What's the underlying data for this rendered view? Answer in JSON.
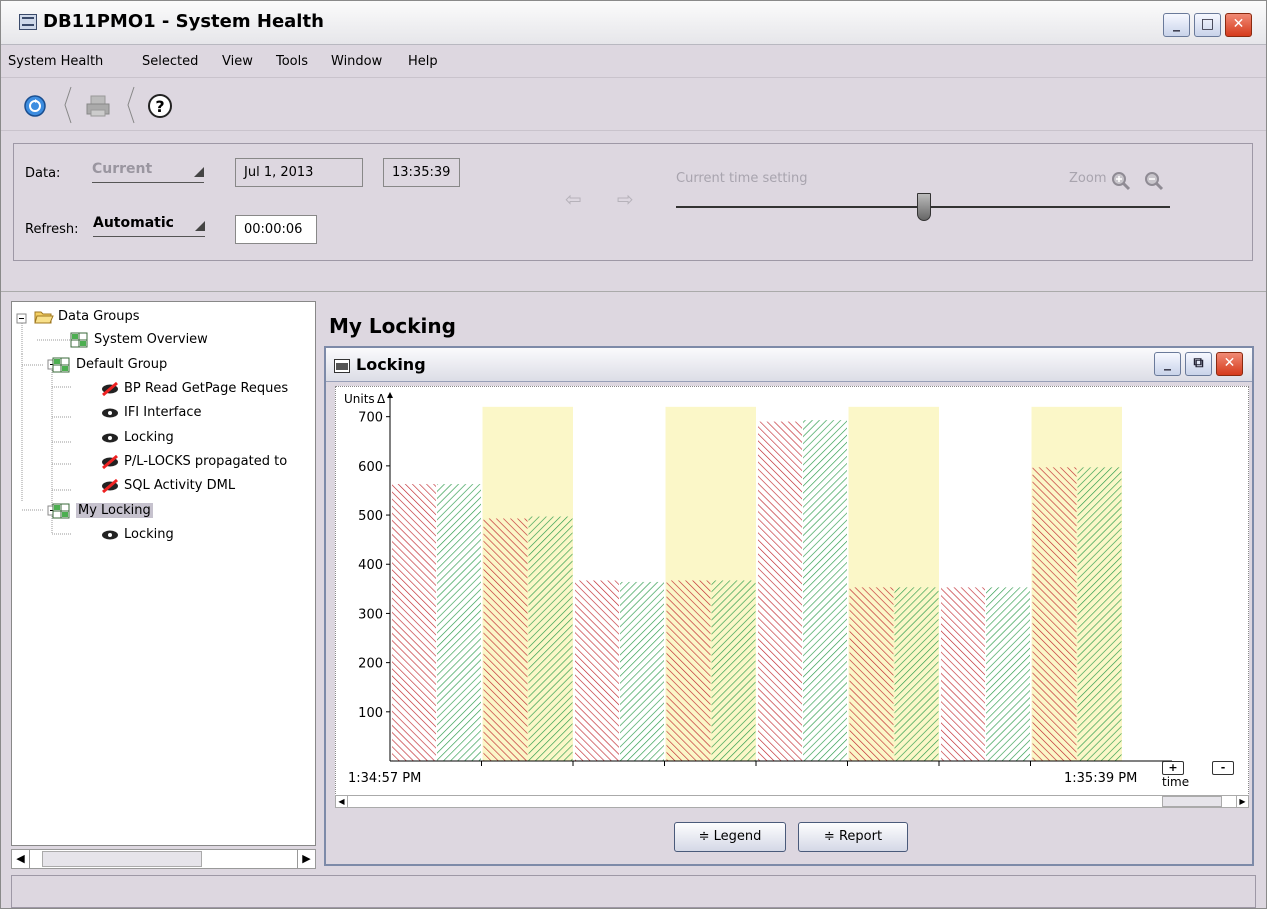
{
  "window": {
    "title": "DB11PMO1 - System Health"
  },
  "menu": [
    {
      "label": "System Health",
      "mnemonic": "y"
    },
    {
      "label": "Selected",
      "mnemonic": "S"
    },
    {
      "label": "View",
      "mnemonic": "V"
    },
    {
      "label": "Tools",
      "mnemonic": "T"
    },
    {
      "label": "Window",
      "mnemonic": "W"
    },
    {
      "label": "Help",
      "mnemonic": "H"
    }
  ],
  "toolbar": {
    "icons": [
      "refresh-icon",
      "print-icon",
      "help-icon"
    ]
  },
  "controls": {
    "data_label": "Data:",
    "data_mode": "Current",
    "date": "Jul 1, 2013",
    "time": "13:35:39",
    "refresh_label": "Refresh:",
    "refresh_mode": "Automatic",
    "refresh_interval": "00:00:06",
    "time_setting_label": "Current time setting",
    "zoom_label": "Zoom"
  },
  "tree": {
    "items": [
      {
        "label": "Data Groups",
        "icon": "folder-open-icon"
      },
      {
        "label": "System Overview",
        "icon": "grid-icon"
      },
      {
        "label": "Default Group",
        "icon": "grid-icon"
      },
      {
        "label": "BP Read GetPage Reques",
        "icon": "eye-disabled-icon"
      },
      {
        "label": "IFI Interface",
        "icon": "eye-icon"
      },
      {
        "label": "Locking",
        "icon": "eye-icon"
      },
      {
        "label": "P/L-LOCKS propagated to",
        "icon": "eye-disabled-icon"
      },
      {
        "label": "SQL Activity DML",
        "icon": "eye-disabled-icon"
      },
      {
        "label": "My Locking",
        "icon": "grid-icon",
        "selected": true
      },
      {
        "label": "Locking",
        "icon": "eye-icon"
      }
    ]
  },
  "main": {
    "title": "My Locking",
    "panel_title": "Locking",
    "buttons": {
      "legend": "Legend",
      "report": "Report"
    },
    "zoom_in": "+",
    "zoom_out": "-"
  },
  "chart_data": {
    "type": "bar",
    "ylabel": "Units",
    "xlabel": "time",
    "ylim": [
      0,
      740
    ],
    "yticks": [
      100,
      200,
      300,
      400,
      500,
      600,
      700
    ],
    "x_start_label": "1:34:57 PM",
    "x_end_label": "1:35:39 PM",
    "intervals": [
      {
        "red": 563,
        "green": 563,
        "highlight": false
      },
      {
        "red": 493,
        "green": 497,
        "highlight": true
      },
      {
        "red": 367,
        "green": 364,
        "highlight": false
      },
      {
        "red": 367,
        "green": 367,
        "highlight": true
      },
      {
        "red": 690,
        "green": 693,
        "highlight": false
      },
      {
        "red": 353,
        "green": 353,
        "highlight": true
      },
      {
        "red": 353,
        "green": 353,
        "highlight": false
      },
      {
        "red": 597,
        "green": 597,
        "highlight": true
      }
    ],
    "highlight_top": 720,
    "colors": {
      "red": "#c0282e",
      "green": "#2a9a4a",
      "highlight": "#fbf7c8"
    }
  }
}
